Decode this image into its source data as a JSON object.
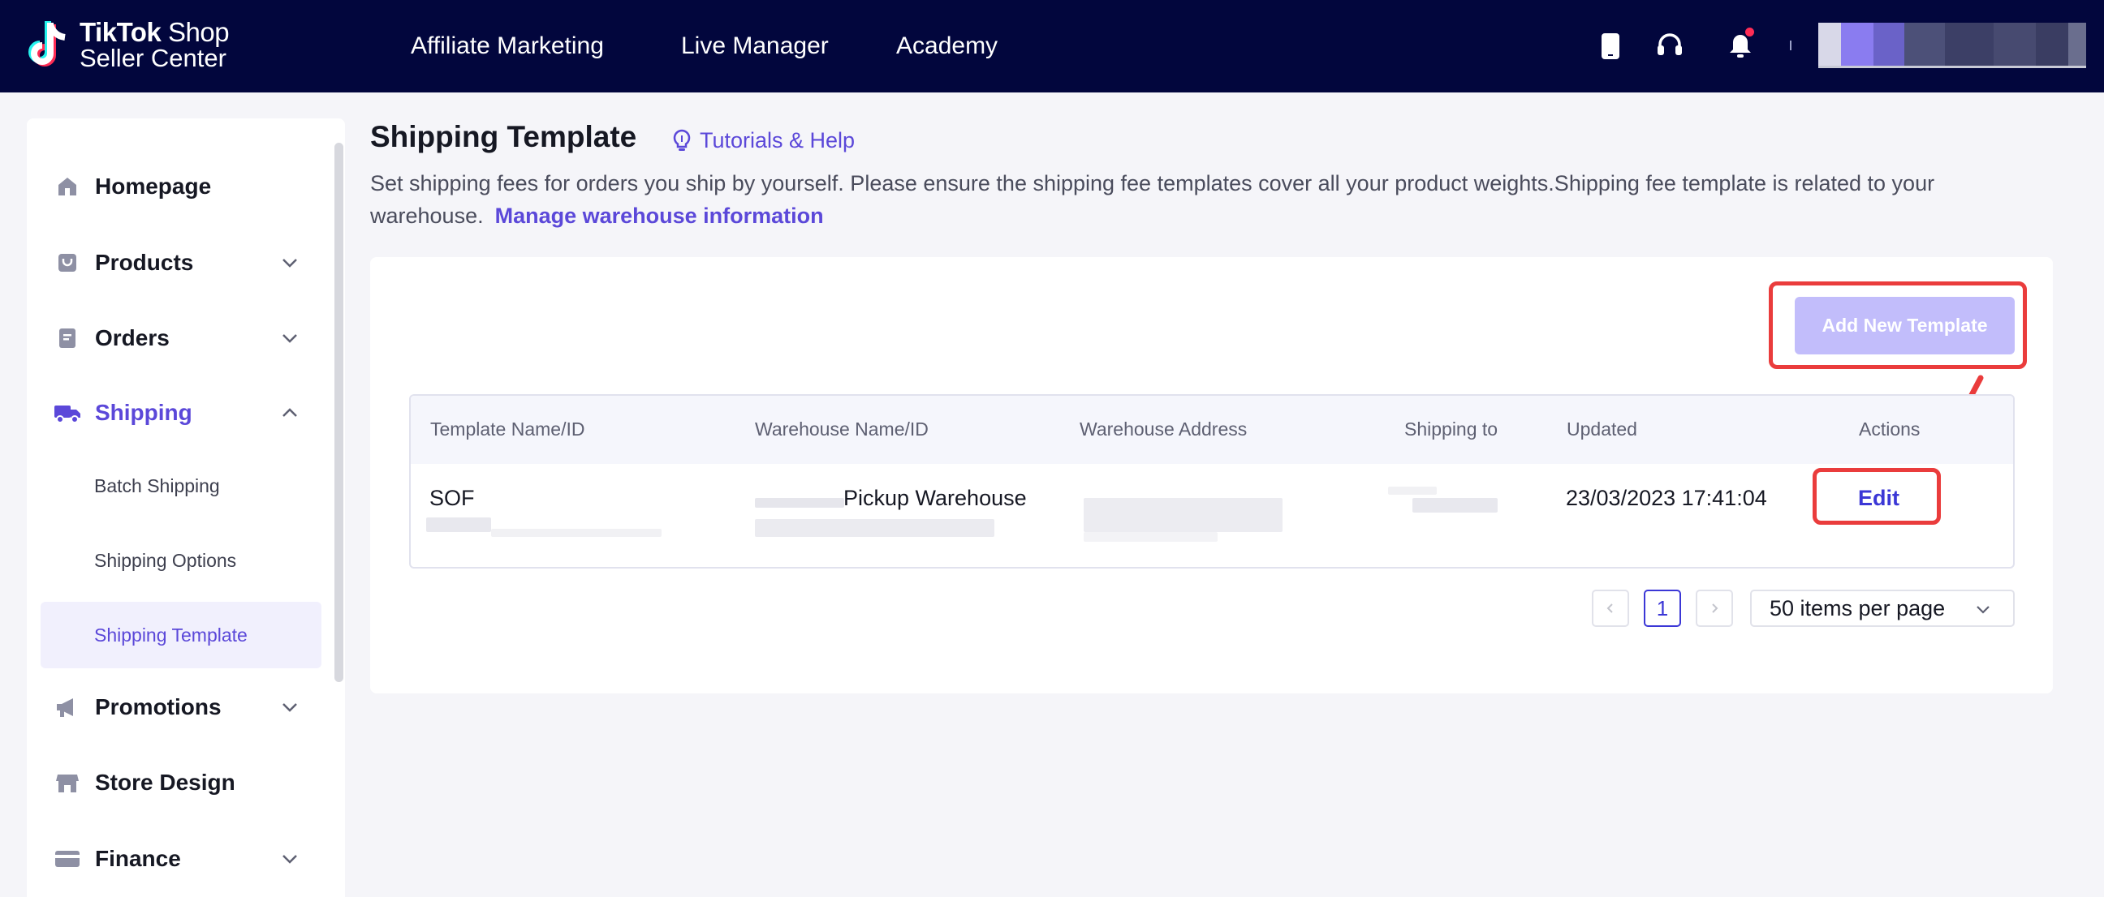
{
  "header": {
    "logo_line1": "TikTok",
    "logo_line1_suffix": " Shop",
    "logo_line2": "Seller Center",
    "nav": [
      {
        "label": "Affiliate Marketing"
      },
      {
        "label": "Live Manager"
      },
      {
        "label": "Academy"
      }
    ],
    "icons": [
      "mobile-icon",
      "headset-icon",
      "bell-icon"
    ],
    "colors": {
      "background": "#02063d",
      "notification_dot": "#fe2c55"
    }
  },
  "sidebar": {
    "items": [
      {
        "label": "Homepage",
        "icon": "home-icon"
      },
      {
        "label": "Products",
        "icon": "bag-icon",
        "expandable": true
      },
      {
        "label": "Orders",
        "icon": "document-icon",
        "expandable": true
      },
      {
        "label": "Shipping",
        "icon": "truck-icon",
        "expandable": true,
        "expanded": true
      },
      {
        "label": "Promotions",
        "icon": "megaphone-icon",
        "expandable": true
      },
      {
        "label": "Store Design",
        "icon": "store-icon"
      },
      {
        "label": "Finance",
        "icon": "wallet-icon",
        "expandable": true
      }
    ],
    "shipping_subitems": [
      {
        "label": "Batch Shipping"
      },
      {
        "label": "Shipping Options"
      },
      {
        "label": "Shipping Template",
        "active": true
      }
    ],
    "accent_color": "#5b48d9"
  },
  "main": {
    "title": "Shipping Template",
    "help_label": "Tutorials & Help",
    "description": "Set shipping fees for orders you ship by yourself. Please ensure the shipping fee templates cover all your product weights.Shipping fee template is related to your warehouse.",
    "manage_link": "Manage warehouse information",
    "add_button": "Add New Template",
    "table": {
      "columns": [
        "Template Name/ID",
        "Warehouse Name/ID",
        "Warehouse Address",
        "Shipping to",
        "Updated",
        "Actions"
      ],
      "rows": [
        {
          "template_name": "SOF",
          "warehouse_name": "Pickup Warehouse",
          "updated": "23/03/2023 17:41:04",
          "action": "Edit"
        }
      ]
    },
    "pagination": {
      "current_page": "1",
      "per_page": "50 items per page"
    },
    "highlight_color": "#ea3c3c"
  }
}
